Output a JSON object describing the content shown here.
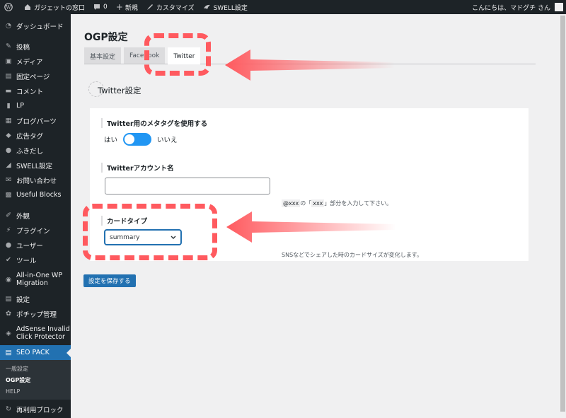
{
  "adminbar": {
    "site_name": "ガジェットの窓口",
    "comments_count": "0",
    "new_label": "新規",
    "customize_label": "カスタマイズ",
    "swell_label": "SWELL設定",
    "greeting": "こんにちは、マドグチ さん"
  },
  "sidebar": {
    "items": [
      {
        "label": "ダッシュボード",
        "icon": "dashboard-icon"
      },
      {
        "label": "投稿",
        "icon": "pin-icon"
      },
      {
        "label": "メディア",
        "icon": "media-icon"
      },
      {
        "label": "固定ページ",
        "icon": "page-icon"
      },
      {
        "label": "コメント",
        "icon": "comment-icon"
      },
      {
        "label": "LP",
        "icon": "lp-icon"
      },
      {
        "label": "ブログパーツ",
        "icon": "blog-parts-icon"
      },
      {
        "label": "広告タグ",
        "icon": "ad-tag-icon"
      },
      {
        "label": "ふきだし",
        "icon": "balloon-icon"
      },
      {
        "label": "SWELL設定",
        "icon": "swell-icon"
      },
      {
        "label": "お問い合わせ",
        "icon": "mail-icon"
      },
      {
        "label": "Useful Blocks",
        "icon": "blocks-icon"
      },
      {
        "label": "外観",
        "icon": "brush-icon"
      },
      {
        "label": "プラグイン",
        "icon": "plugin-icon"
      },
      {
        "label": "ユーザー",
        "icon": "user-icon"
      },
      {
        "label": "ツール",
        "icon": "wrench-icon"
      },
      {
        "label": "All-in-One WP Migration",
        "icon": "migration-icon"
      },
      {
        "label": "設定",
        "icon": "settings-icon"
      },
      {
        "label": "ポチップ管理",
        "icon": "paw-icon"
      },
      {
        "label": "AdSense Invalid Click Protector",
        "icon": "shield-icon"
      },
      {
        "label": "SEO PACK",
        "icon": "seo-icon"
      }
    ],
    "submenu": [
      "一般設定",
      "OGP設定",
      "HELP"
    ],
    "reuse_label": "再利用ブロック"
  },
  "main": {
    "title": "OGP設定",
    "tabs": [
      "基本設定",
      "Facebook",
      "Twitter"
    ],
    "section_title": "Twitter設定",
    "meta_label": "Twitter用のメタタグを使用する",
    "toggle_yes": "はい",
    "toggle_no": "いいえ",
    "account_label": "Twitterアカウント名",
    "account_value": "",
    "account_help_code": "@xxx",
    "account_help_mid": " の「",
    "account_help_code2": "xxx",
    "account_help_end": "」部分を入力して下さい。",
    "card_label": "カードタイプ",
    "card_value": "summary",
    "card_help": "SNSなどでシェアした時のカードサイズが変化します。",
    "save_label": "設定を保存する"
  },
  "colors": {
    "accent": "#2271b1",
    "toggle_on": "#2196f3",
    "annotation": "#ff5a5f",
    "sidebar_bg": "#1d2327"
  }
}
